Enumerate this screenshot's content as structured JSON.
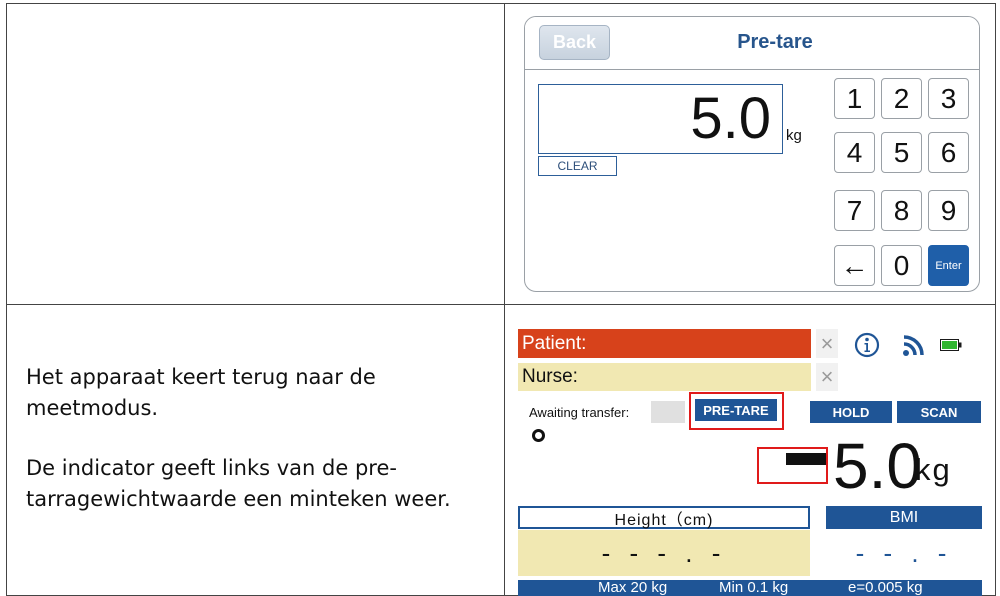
{
  "pretare_panel": {
    "back_label": "Back",
    "title": "Pre-tare",
    "value": "5.0",
    "unit": "kg",
    "clear_label": "CLEAR",
    "keys": [
      "1",
      "2",
      "3",
      "4",
      "5",
      "6",
      "7",
      "8",
      "9",
      "←",
      "0",
      "Enter"
    ]
  },
  "description": {
    "paragraph1": "Het apparaat keert terug naar de meetmodus.",
    "paragraph2": "De indicator geeft links van de pre-tarragewichtwaarde een minteken weer."
  },
  "weigh_screen": {
    "patient_label": "Patient:",
    "nurse_label": "Nurse:",
    "clear_symbol": "×",
    "awaiting_label": "Awaiting transfer:",
    "pretare_btn": "PRE-TARE",
    "hold_btn": "HOLD",
    "scan_btn": "SCAN",
    "weight_value": "5.0",
    "weight_unit": "kg",
    "height_label": "Height（cm)",
    "height_value": "- - - . -",
    "bmi_label": "BMI",
    "bmi_value": "- - . -",
    "footer_max": "Max 20 kg",
    "footer_min": "Min 0.1 kg",
    "footer_e": "e=0.005 kg",
    "colors": {
      "patient_bar": "#d7421b",
      "nurse_bar": "#f1e8b2",
      "brand_blue": "#1f5596",
      "highlight": "#e01a1a"
    }
  }
}
